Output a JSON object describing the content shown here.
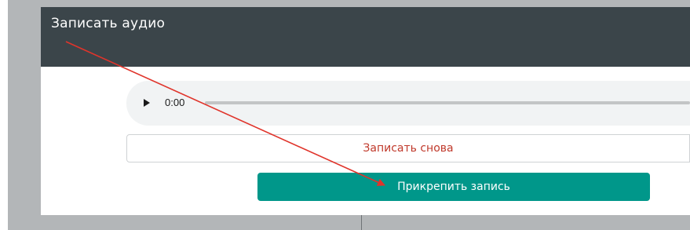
{
  "modal": {
    "title": "Записать аудио"
  },
  "audio_player": {
    "play_icon": "play-icon",
    "current_time": "0:00"
  },
  "buttons": {
    "record_again_label": "Записать снова",
    "attach_label": "Прикрепить запись"
  },
  "colors": {
    "header_bg": "#3b454a",
    "backdrop": "#b3b6b8",
    "primary_button": "#00978a",
    "record_again_text": "#c0392b",
    "annotation_arrow": "#e0342b"
  }
}
